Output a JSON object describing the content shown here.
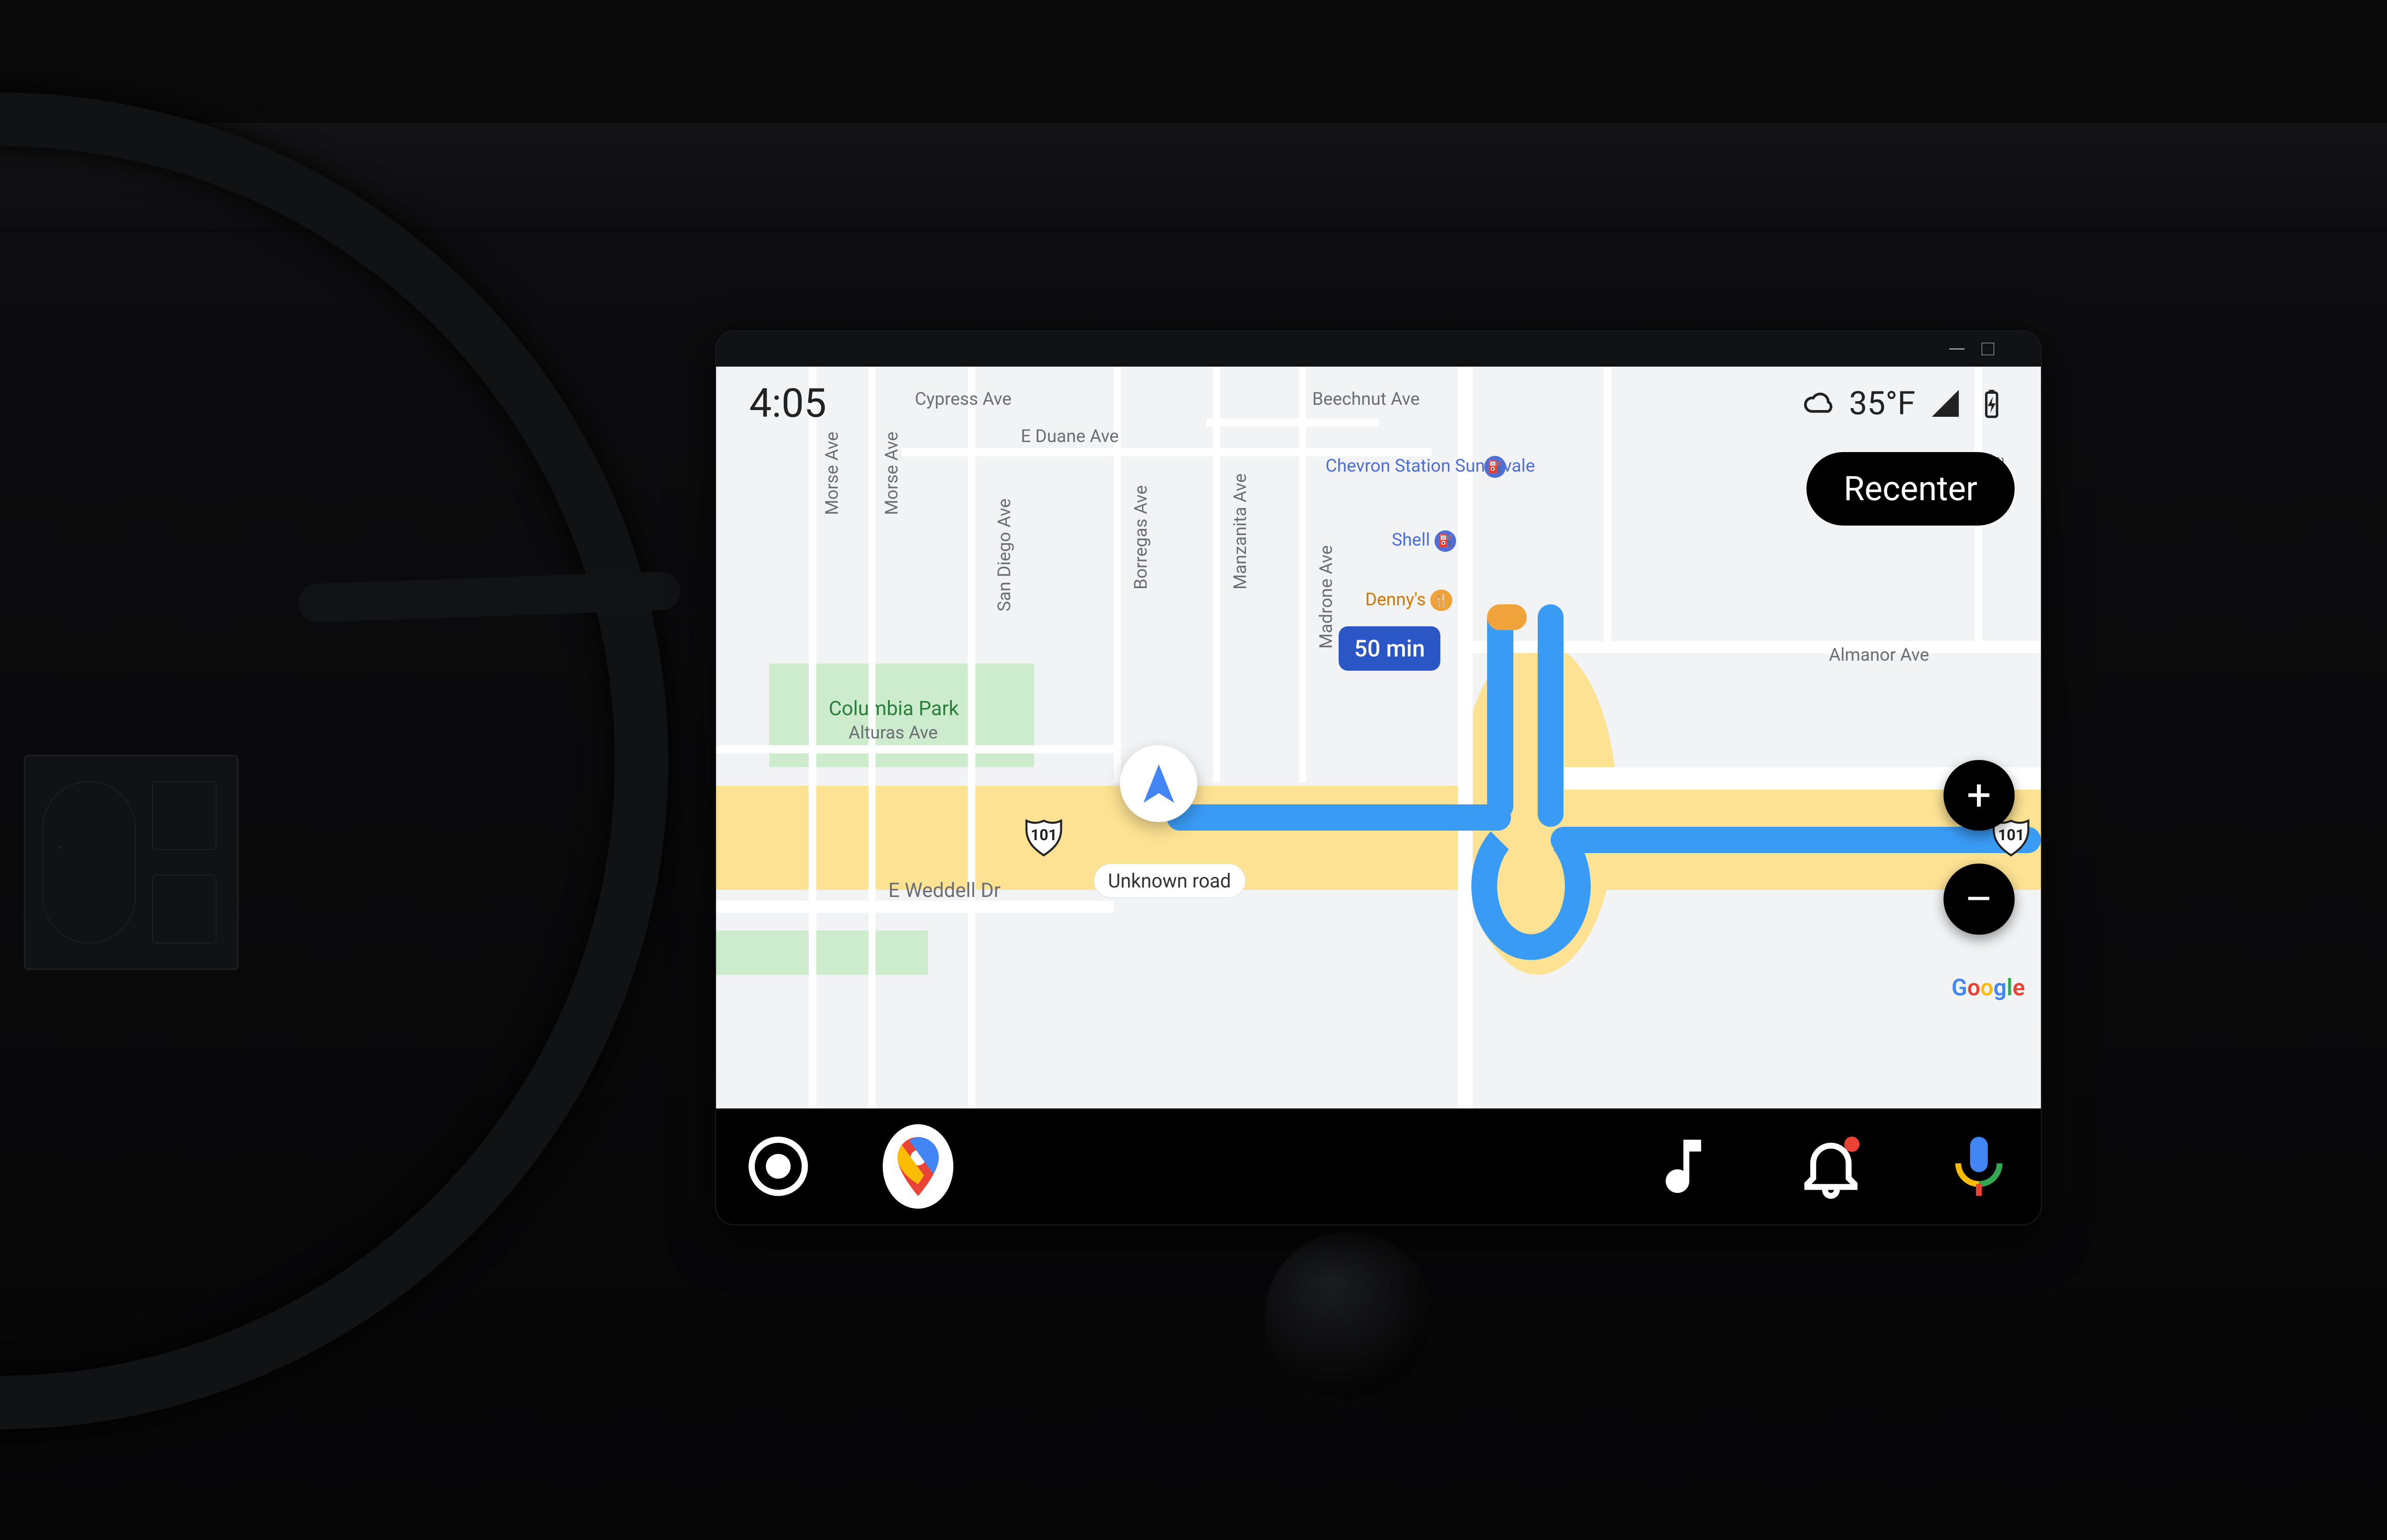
{
  "window": {
    "minimize": "–",
    "maximize": "□",
    "close": "×"
  },
  "status": {
    "clock": "4:05",
    "weather": {
      "icon": "cloud-icon",
      "temp": "35°F"
    },
    "signal": "signal-icon",
    "battery": "battery-charging-icon"
  },
  "controls": {
    "recenter": "Recenter",
    "zoom_in": "+",
    "zoom_out": "–"
  },
  "route": {
    "traffic_label": "50 min",
    "current_road": "Unknown road",
    "highway_shield_a": "101",
    "highway_shield_b": "101"
  },
  "streets": {
    "morse_ave": "Morse Ave",
    "morse_ave_2": "Morse Ave",
    "cypress_ave": "Cypress Ave",
    "e_duane_ave": "E Duane Ave",
    "san_diego_ave": "San Diego Ave",
    "borregas_ave": "Borregas Ave",
    "manzanita_ave": "Manzanita Ave",
    "madrone_ave": "Madrone Ave",
    "beechnut_ave": "Beechnut Ave",
    "almanor_ave": "Almanor Ave",
    "alturas_ave": "Alturas Ave",
    "e_weddell_dr": "E Weddell Dr",
    "ave_right": "Ave"
  },
  "parks": {
    "columbia": "Columbia Park"
  },
  "pois": {
    "chevron": "Chevron Station Sunnyvale",
    "shell": "Shell",
    "dennys": "Denny's"
  },
  "attribution": {
    "google_letters": [
      "G",
      "o",
      "o",
      "g",
      "l",
      "e"
    ]
  },
  "navbar": {
    "launcher": "launcher-icon",
    "maps": "google-maps-icon",
    "music": "music-note-icon",
    "notifications": "bell-icon",
    "assistant": "assistant-mic-icon"
  }
}
